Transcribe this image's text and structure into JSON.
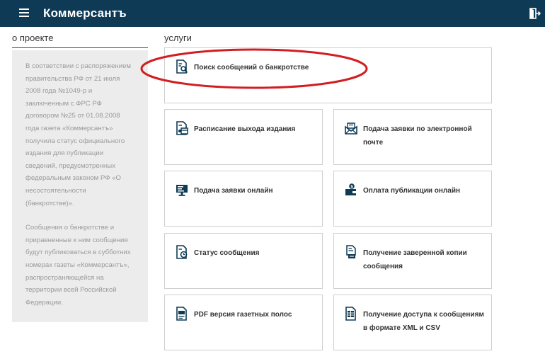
{
  "header": {
    "logo": "Коммерсантъ",
    "menu_icon": "hamburger-menu-icon",
    "logout_icon": "logout-door-icon",
    "bg_color": "#0f3a55"
  },
  "about": {
    "title": "о проекте",
    "paragraphs": [
      "В соответствии с распоряжением правительства РФ от 21 июля 2008 года №1049-р и заключенным с ФРС РФ договором №25 от 01.08.2008 года газета «Коммерсантъ» получила статус официального издания для публикации сведений, предусмотренных федеральным законом РФ «О несостоятельности (банкротстве)».",
      "Сообщения о банкротстве и приравненные к ним сообщения будут публиковаться в субботних номерах газеты «Коммерсантъ», распространяющейся на территории всей Российской Федерации."
    ]
  },
  "services": {
    "title": "услуги",
    "items": [
      {
        "label": "Поиск сообщений о банкротстве",
        "icon": "document-search-icon"
      },
      {
        "label": "Расписание выхода издания",
        "icon": "document-calendar-icon"
      },
      {
        "label": "Подача заявки по электронной почте",
        "icon": "email-envelope-icon"
      },
      {
        "label": "Подача заявки онлайн",
        "icon": "monitor-icon"
      },
      {
        "label": "Оплата публикации онлайн",
        "icon": "wallet-payment-icon"
      },
      {
        "label": "Статус сообщения",
        "icon": "document-status-icon"
      },
      {
        "label": "Получение заверенной копии сообщения",
        "icon": "document-copy-icon"
      },
      {
        "label": "PDF версия газетных полос",
        "icon": "pdf-document-icon"
      },
      {
        "label": "Получение доступа к сообщениям в формате XML и CSV",
        "icon": "data-file-icon"
      }
    ]
  },
  "highlight_color": "#d21e23"
}
